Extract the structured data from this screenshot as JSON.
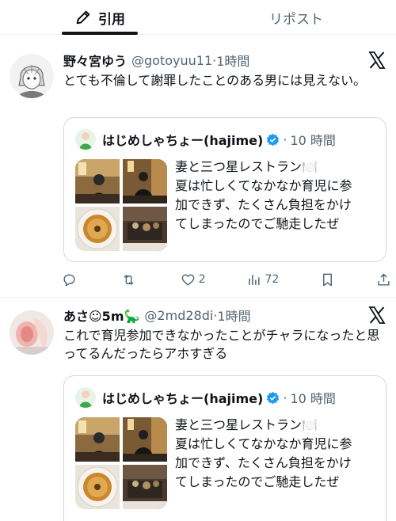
{
  "tabs": [
    {
      "label": "引用",
      "active": true,
      "icon": "pen-icon"
    },
    {
      "label": "リポスト",
      "active": false
    }
  ],
  "posts": [
    {
      "name": "野々宮ゆう",
      "handle": "@gotoyuu11",
      "dot": "·",
      "time": "1時間",
      "text": "とても不倫して謝罪したことのある男には見えない。",
      "quote": {
        "name": "はじめしゃちょー(hajime)",
        "dot": "·",
        "time": "10 時間",
        "text_lines": [
          "妻と三つ星レストラン🍽️",
          "夏は忙しくてなかなか育児に参",
          "加できず、たくさん負担をかけ",
          "てしまったのでご馳走したぜ"
        ]
      },
      "actions": {
        "replies": "",
        "reposts": "",
        "likes": "2",
        "views": "72"
      }
    },
    {
      "name": "あさ☺5m🦕",
      "handle": "@2md28di",
      "dot": "·",
      "time": "1時間",
      "text": "これで育児参加できなかったことがチャラになったと思ってるんだったらアホすぎる",
      "quote": {
        "name": "はじめしゃちょー(hajime)",
        "dot": "·",
        "time": "10 時間",
        "text_lines": [
          "妻と三つ星レストラン🍽️",
          "夏は忙しくてなかなか育児に参",
          "加できず、たくさん負担をかけ",
          "てしまったのでご馳走したぜ"
        ]
      }
    }
  ],
  "colors": {
    "text": "#0f1419",
    "secondary": "#536471",
    "border": "#cfd9de",
    "verified": "#1d9bf0"
  }
}
